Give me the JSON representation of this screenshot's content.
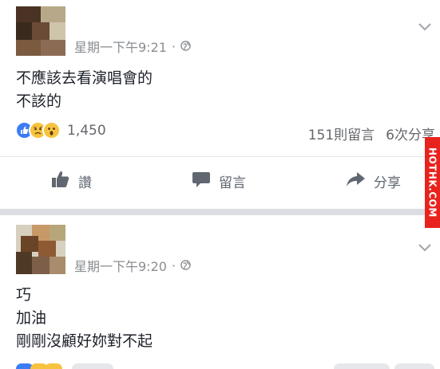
{
  "posts": [
    {
      "timestamp": "星期一下午9:21",
      "dot": "·",
      "lines": [
        "不應該去看演唱會的",
        "不該的"
      ],
      "reaction_count": "1,450",
      "comments": "151則留言",
      "shares": "6次分享",
      "actions": {
        "like": "讚",
        "comment": "留言",
        "share": "分享"
      }
    },
    {
      "timestamp": "星期一下午9:20",
      "dot": "·",
      "lines": [
        "巧",
        "加油",
        "剛剛沒顧好妳對不起"
      ]
    }
  ],
  "watermark": "HOTHK.COM",
  "colors": {
    "like_blue": "#3b7cf7",
    "reaction_yellow": "#f7c33e",
    "muted": "#8a8d91",
    "watermark_red": "#e8231e"
  },
  "icons": [
    "globe-icon",
    "chevron-down-icon",
    "like-icon",
    "sad-icon",
    "wow-icon",
    "thumbs-up-icon",
    "comment-icon",
    "share-icon"
  ]
}
